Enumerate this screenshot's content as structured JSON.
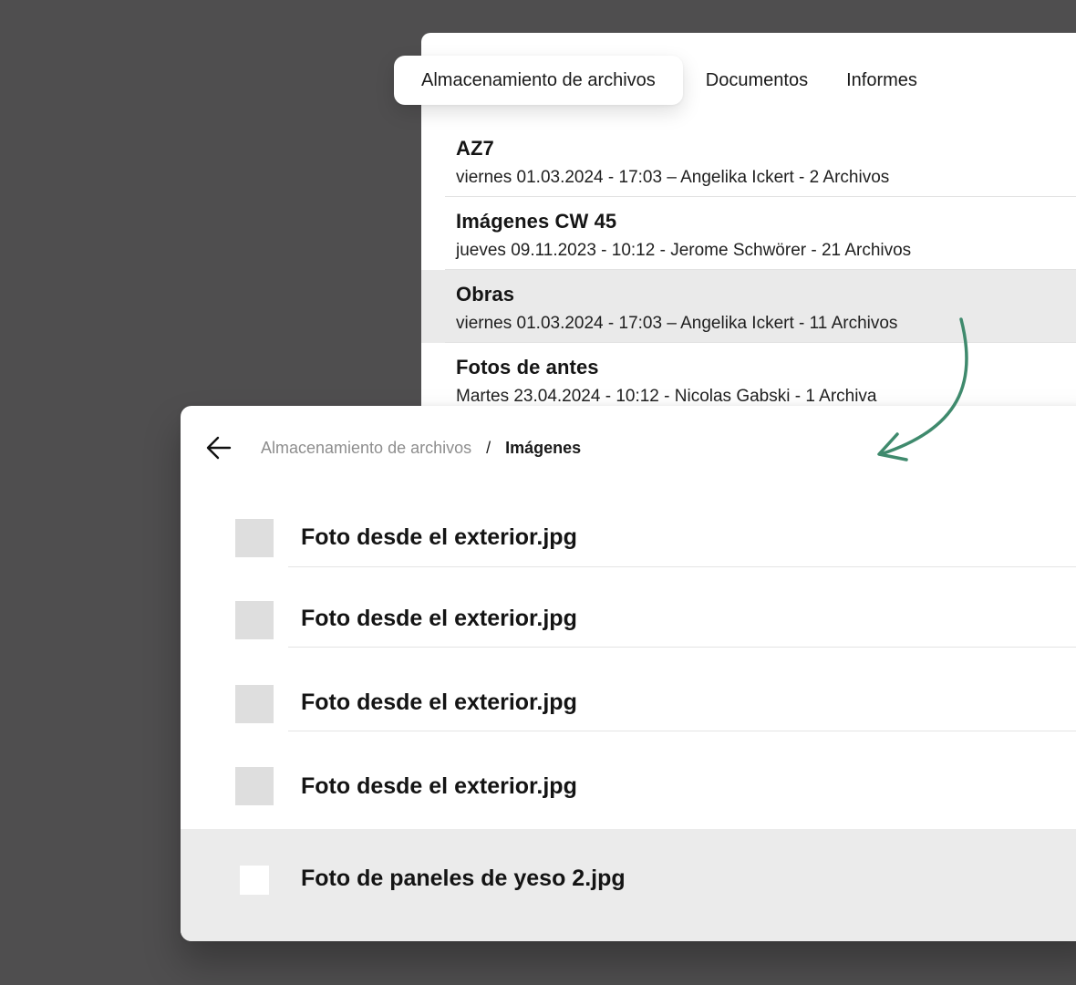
{
  "tabs": [
    {
      "label": "Almacenamiento de archivos",
      "active": true
    },
    {
      "label": "Documentos",
      "active": false
    },
    {
      "label": "Informes",
      "active": false
    }
  ],
  "folders": [
    {
      "title": "AZ7",
      "meta": "viernes 01.03.2024 - 17:03 – Angelika Ickert - 2 Archivos",
      "highlighted": false
    },
    {
      "title": "Imágenes CW 45",
      "meta": "jueves 09.11.2023 - 10:12 - Jerome Schwörer - 21 Archivos",
      "highlighted": false
    },
    {
      "title": "Obras",
      "meta": "viernes 01.03.2024 - 17:03 – Angelika Ickert - 11 Archivos",
      "highlighted": true
    },
    {
      "title": "Fotos de antes",
      "meta": "Martes 23.04.2024 - 10:12 - Nicolas Gabski - 1 Archiva",
      "highlighted": false
    }
  ],
  "breadcrumb": {
    "root": "Almacenamiento de archivos",
    "separator": "/",
    "current": "Imágenes"
  },
  "files": [
    {
      "name": "Foto desde el exterior.jpg",
      "selected": false
    },
    {
      "name": "Foto desde el exterior.jpg",
      "selected": false
    },
    {
      "name": "Foto desde el exterior.jpg",
      "selected": false
    },
    {
      "name": "Foto desde el exterior.jpg",
      "selected": false
    },
    {
      "name": "Foto de paneles de yeso 2.jpg",
      "selected": true
    }
  ],
  "icons": {
    "back": "arrow-left-icon",
    "connector": "curved-arrow-icon"
  },
  "colors": {
    "background": "#4f4e4f",
    "accent_arrow": "#3f8a6d",
    "highlight_row": "#eaeaea",
    "thumbnail": "#dedede"
  }
}
